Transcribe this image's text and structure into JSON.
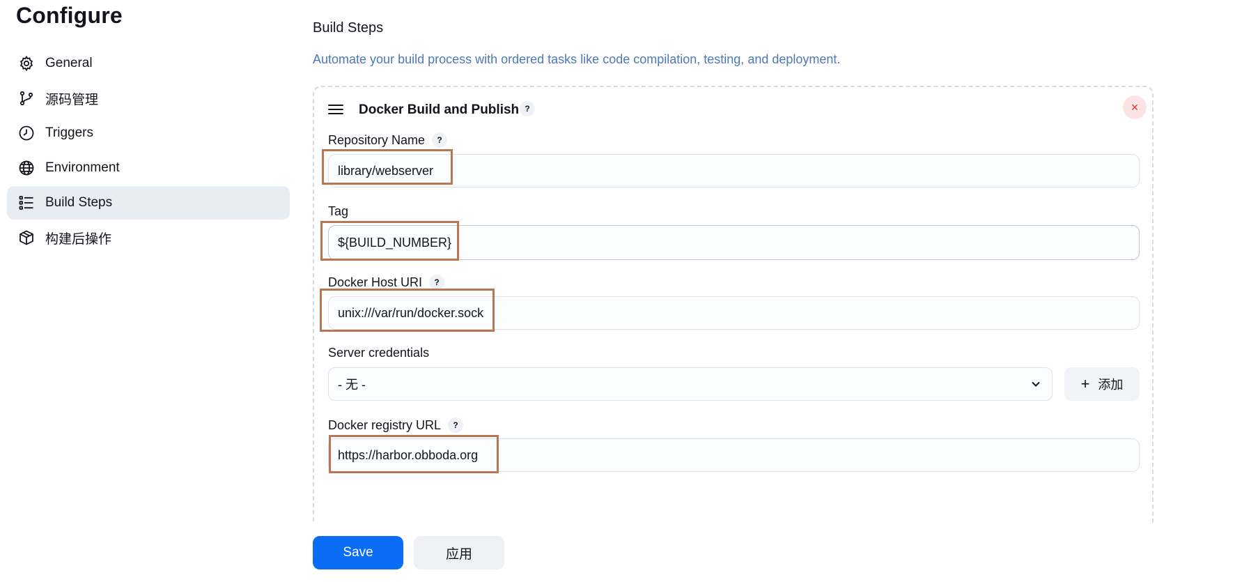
{
  "page": {
    "title": "Configure"
  },
  "sidebar": {
    "items": [
      {
        "label": "General",
        "icon": "gear-icon"
      },
      {
        "label": "源码管理",
        "icon": "source-branch-icon"
      },
      {
        "label": "Triggers",
        "icon": "clock-icon"
      },
      {
        "label": "Environment",
        "icon": "globe-icon"
      },
      {
        "label": "Build Steps",
        "icon": "list-icon",
        "active": true
      },
      {
        "label": "构建后操作",
        "icon": "package-icon"
      }
    ]
  },
  "main": {
    "section_title": "Build Steps",
    "section_desc": "Automate your build process with ordered tasks like code compilation, testing, and deployment.",
    "step": {
      "title": "Docker Build and Publish",
      "help": "?",
      "close": "×",
      "fields": {
        "repo_label": "Repository Name",
        "repo_value": "library/webserver",
        "tag_label": "Tag",
        "tag_value": "${BUILD_NUMBER}",
        "host_label": "Docker Host URI",
        "host_value": "unix:///var/run/docker.sock",
        "cred_label": "Server credentials",
        "cred_value": "- 无 -",
        "add_label": "添加",
        "registry_label": "Docker registry URL",
        "registry_value": "https://harbor.obboda.org"
      }
    }
  },
  "footer": {
    "save_label": "Save",
    "apply_label": "应用"
  },
  "colors": {
    "primary": "#0b6cf5",
    "highlight": "#b87752",
    "link_text": "#4b78b8",
    "active_bg": "#e8ecf3"
  }
}
